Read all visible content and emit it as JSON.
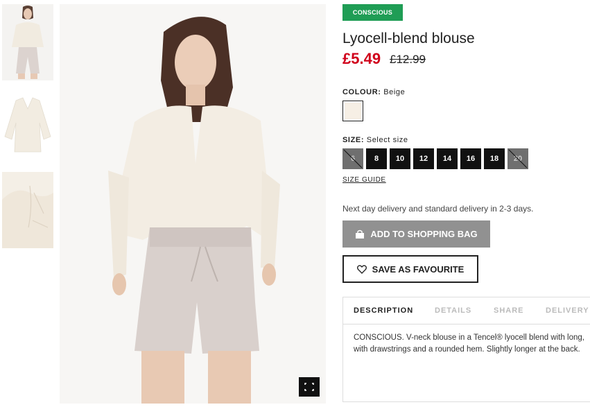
{
  "product": {
    "badge": "CONSCIOUS",
    "title": "Lyocell-blend blouse",
    "price": "£5.49",
    "old_price": "£12.99"
  },
  "colour": {
    "label": "COLOUR:",
    "value": "Beige",
    "swatch_color": "#f6efe5"
  },
  "size": {
    "label": "SIZE:",
    "value": "Select size",
    "options": [
      {
        "label": "6",
        "available": false
      },
      {
        "label": "8",
        "available": true
      },
      {
        "label": "10",
        "available": true
      },
      {
        "label": "12",
        "available": true
      },
      {
        "label": "14",
        "available": true
      },
      {
        "label": "16",
        "available": true
      },
      {
        "label": "18",
        "available": true
      },
      {
        "label": "20",
        "available": false
      }
    ],
    "guide": "SIZE GUIDE"
  },
  "delivery": "Next day delivery and standard delivery in 2-3 days.",
  "buttons": {
    "add_to_bag": "ADD TO SHOPPING BAG",
    "favourite": "SAVE AS FAVOURITE"
  },
  "tabs": [
    "DESCRIPTION",
    "DETAILS",
    "SHARE",
    "DELIVERY"
  ],
  "description": {
    "line1": "CONSCIOUS. V-neck blouse in a Tencel® lyocell blend with long,",
    "line2": "with drawstrings and a rounded hem. Slightly longer at the back."
  },
  "colors": {
    "badge_green": "#1f9d55",
    "sale_red": "#d0021b",
    "bag_button_grey": "#919191"
  }
}
